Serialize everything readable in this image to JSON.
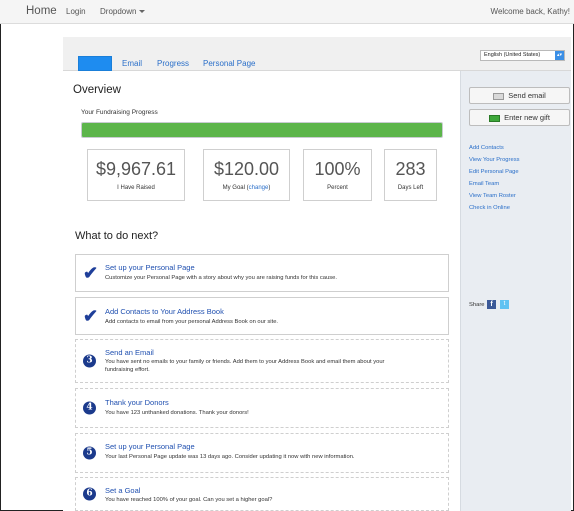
{
  "nav": {
    "brand": "Home",
    "login": "Login",
    "dropdown": "Dropdown",
    "welcome": "Welcome back, Kathy!"
  },
  "tabs": {
    "active": "",
    "email": "Email",
    "progress": "Progress",
    "personal_page": "Personal Page"
  },
  "language": {
    "selected": "English (United States)"
  },
  "overview": {
    "title": "Overview",
    "progress_label": "Your Fundraising Progress",
    "progress_fraction": 1.0,
    "stats": [
      {
        "value": "$9,967.61",
        "label": "I Have Raised"
      },
      {
        "value": "$120.00",
        "label": "My Goal (",
        "link": "change",
        "label_after": ")"
      },
      {
        "value": "100%",
        "label": "Percent"
      },
      {
        "value": "283",
        "label": "Days Left"
      }
    ]
  },
  "next": {
    "title": "What to do next?",
    "steps": [
      {
        "status": "done",
        "title": "Set up your Personal Page",
        "desc": "Customize your Personal Page with a story about why you are raising funds for this cause."
      },
      {
        "status": "done",
        "title": "Add Contacts to Your Address Book",
        "desc": "Add contacts to email from your personal Address Book on our site."
      },
      {
        "status": "todo",
        "number": "3",
        "title": "Send an Email",
        "desc": "You have sent no emails to your family or friends. Add them to your Address Book and email them about your fundraising effort."
      },
      {
        "status": "todo",
        "number": "4",
        "title": "Thank your Donors",
        "desc": "You have 123 unthanked donations. Thank your donors!"
      },
      {
        "status": "todo",
        "number": "5",
        "title": "Set up your Personal Page",
        "desc": "Your last Personal Page update was 13 days ago. Consider updating it now with new information."
      },
      {
        "status": "todo",
        "number": "6",
        "title": "Set a Goal",
        "desc": "You have reached 100% of your goal. Can you set a higher goal?"
      }
    ]
  },
  "sidebar": {
    "send_email": "Send email",
    "enter_gift": "Enter new gift",
    "links": [
      "Add Contacts",
      "View Your Progress",
      "Edit Personal Page",
      "Email Team",
      "View Team Roster",
      "Check in Online"
    ],
    "share": "Share"
  },
  "colors": {
    "accent": "#1e8cf0",
    "progress": "#5cb54a",
    "link": "#2a6fc9",
    "step_number": "#1b3a8c"
  },
  "icons": {
    "check": "check-icon",
    "facebook": "facebook-icon",
    "twitter": "twitter-icon",
    "envelope": "envelope-icon",
    "gift": "gift-icon"
  }
}
